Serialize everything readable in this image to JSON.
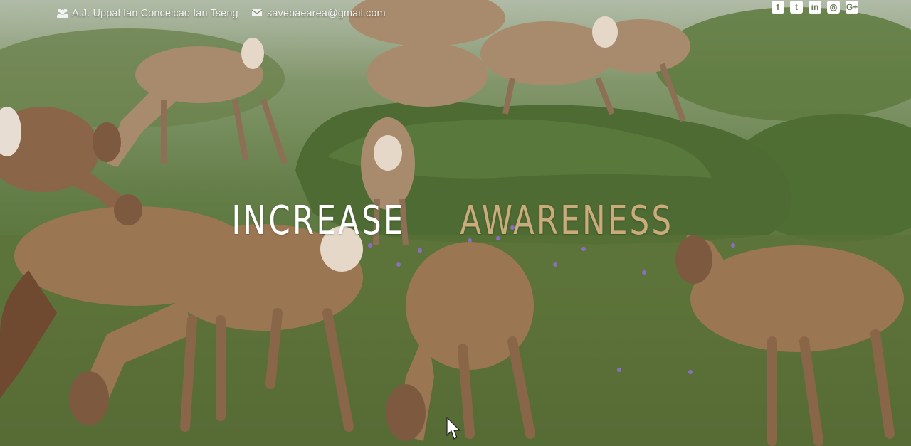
{
  "topbar": {
    "names_icon": "users-icon",
    "names": "A.J. Uppal Ian Conceicao Ian Tseng",
    "email_icon": "envelope-icon",
    "email": "savebaearea@gmail.com",
    "social": [
      {
        "icon": "facebook-icon",
        "glyph": "f"
      },
      {
        "icon": "twitter-icon",
        "glyph": "t"
      },
      {
        "icon": "linkedin-icon",
        "glyph": "in"
      },
      {
        "icon": "instagram-icon",
        "glyph": "◎"
      },
      {
        "icon": "google-plus-icon",
        "glyph": "G+"
      }
    ]
  },
  "hero": {
    "title_part1": "INCREASE",
    "title_part2": "AWARENESS",
    "title_color_1": "#ffffff",
    "title_color_2": "#c9ab7c",
    "background_description": "herd of elk grazing on green meadow with shrubs and purple wildflowers"
  }
}
